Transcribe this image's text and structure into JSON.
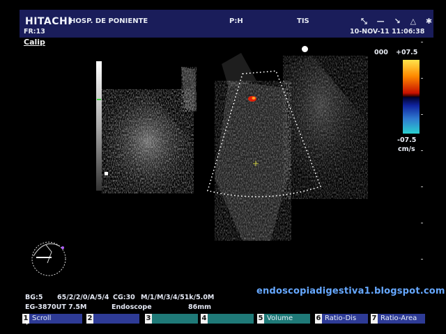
{
  "header": {
    "logo": "HITACHI",
    "hospital": "HOSP. DE PONIENTE",
    "label_ph": "P:H",
    "label_tis": "TIS",
    "frame_rate": "FR:13",
    "datetime": "10-NOV-11 11:06:38",
    "icons": [
      "measurement-icon",
      "minus-icon",
      "probe-icon",
      "warning-icon",
      "settings-icon"
    ]
  },
  "mode_label": "Calip",
  "color_scale": {
    "gain": "000",
    "max": "+07.5",
    "min": "-07.5",
    "unit": "cm/s",
    "colors": [
      "#ffe44c",
      "#ff8a00",
      "#c81000",
      "#1024a0",
      "#2f7ad0",
      "#2ad0d0"
    ]
  },
  "watermark": "endoscopiadigestiva1.blogspot.com",
  "info": {
    "bg": "BG:5",
    "params1": "65/2/2/0/A/5/4",
    "cg": "CG:30",
    "params2": "M/1/M/3/4/51k/5.0M",
    "probe": "EG-3870UT 7.5M",
    "mode": "Endoscope",
    "depth": "86mm"
  },
  "softkeys": [
    {
      "num": "1",
      "label": "Scroll"
    },
    {
      "num": "2",
      "label": ""
    },
    {
      "num": "3",
      "label": ""
    },
    {
      "num": "4",
      "label": ""
    },
    {
      "num": "5",
      "label": "Volume"
    },
    {
      "num": "6",
      "label": "Ratio-Dis"
    },
    {
      "num": "7",
      "label": "Ratio-Area"
    }
  ]
}
